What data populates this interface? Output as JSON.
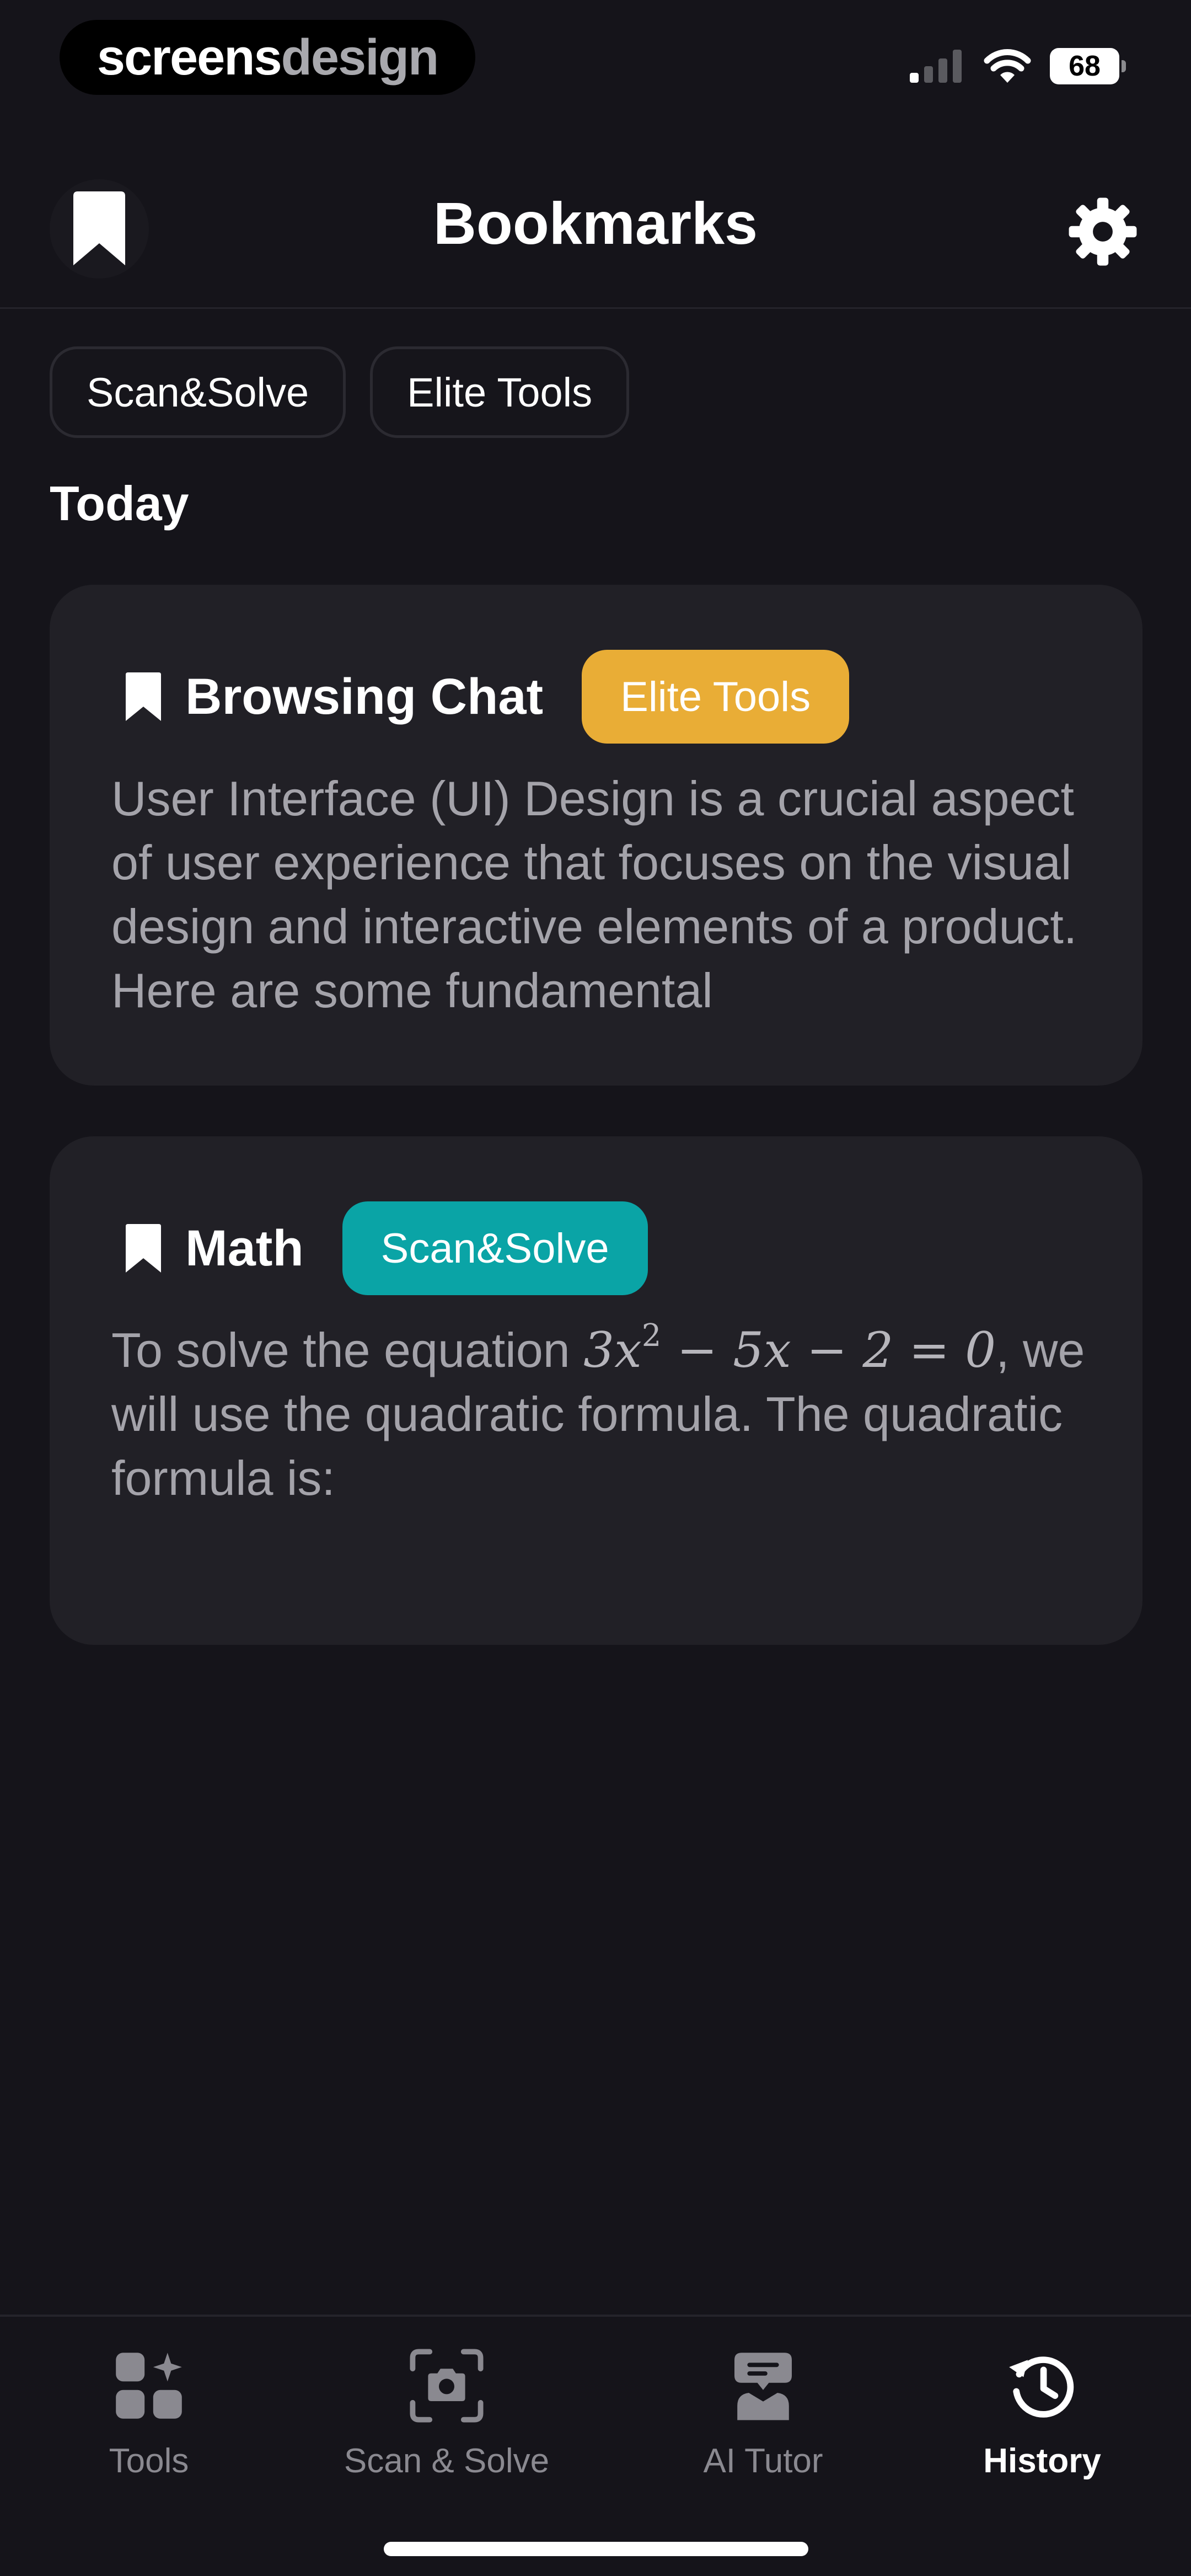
{
  "status_bar": {
    "brand_part1": "screens",
    "brand_part2": "design",
    "battery": "68"
  },
  "header": {
    "title": "Bookmarks"
  },
  "filters": {
    "chips": [
      "Scan&Solve",
      "Elite Tools"
    ]
  },
  "section": {
    "heading": "Today"
  },
  "cards": [
    {
      "title": "Browsing Chat",
      "tag": "Elite Tools",
      "tag_color": "#e9ad36",
      "body": "User Interface (UI) Design is a crucial aspect of user experience that focuses on the visual design and interactive elements of a product. Here are some fundamental"
    },
    {
      "title": "Math",
      "tag": "Scan&Solve",
      "tag_color": "#0aa4a6",
      "body_before": "To solve the equation ",
      "equation_base": "3x",
      "equation_exp": "2",
      "equation_rest": " − 5x − 2 = 0",
      "body_after": ", we will use the quadratic formula. The quadratic formula is:"
    }
  ],
  "bottom_nav": {
    "items": [
      {
        "label": "Tools",
        "icon": "tools-grid-icon"
      },
      {
        "label": "Scan & Solve",
        "icon": "camera-scan-icon"
      },
      {
        "label": "AI Tutor",
        "icon": "ai-tutor-icon"
      },
      {
        "label": "History",
        "icon": "history-clock-icon"
      }
    ],
    "active": "History"
  },
  "colors": {
    "background": "#15141a",
    "card": "#212026",
    "elite_tag": "#e9ad36",
    "scan_tag": "#0aa4a6",
    "muted_text": "#a4a3aa"
  }
}
